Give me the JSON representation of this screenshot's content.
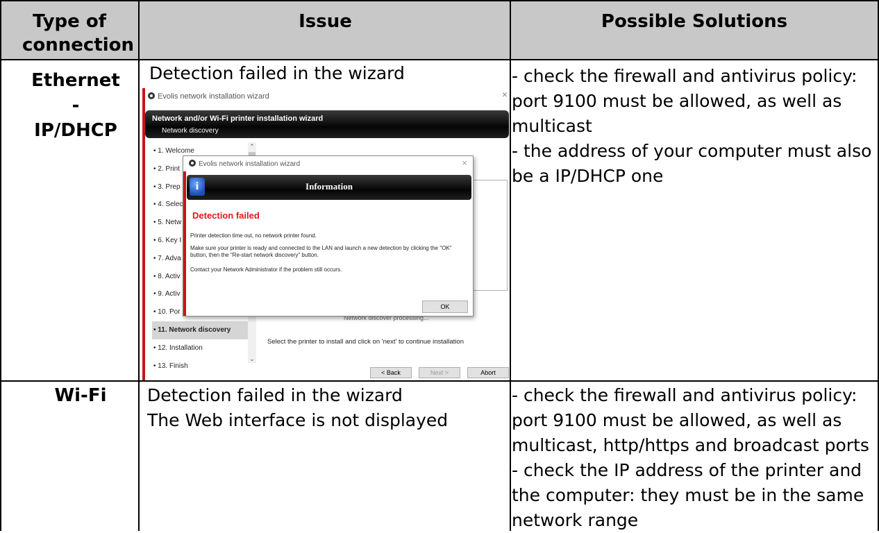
{
  "headers": {
    "type": "Type of connection",
    "issue": "Issue",
    "solutions": "Possible Solutions"
  },
  "rows": [
    {
      "connection": "Ethernet - IP/DHCP",
      "issue_line1": "Detection failed in the wizard",
      "solutions": [
        " - check the firewall and antivirus policy:",
        "port 9100 must be allowed, as well as",
        "multicast",
        " - the address of your computer must also",
        "be a IP/DHCP one"
      ]
    },
    {
      "connection": "Wi-Fi",
      "issue_lines": [
        "Detection failed in the wizard",
        "The Web interface is not displayed"
      ],
      "solutions": [
        " - check the firewall and antivirus policy:",
        "port 9100 must be allowed, as well as",
        "multicast, http/https and broadcast ports",
        "- check the IP address of the printer and",
        "the computer: they must be in the same",
        "network range"
      ]
    }
  ],
  "wizard": {
    "window_title": "Evolis network installation wizard",
    "banner_title": "Network and/or Wi-Fi printer installation wizard",
    "banner_subtitle": "Network discovery",
    "steps": [
      "1. Welcome",
      "2. Print",
      "3. Prep",
      "4. Selec",
      "5. Netw",
      "6. Key I",
      "7. Adva",
      "8. Activ",
      "9. Activ",
      "10. Por",
      "11. Network discovery",
      "12. Installation",
      "13. Finish"
    ],
    "active_step": 10,
    "spinner_text": "Network discover processing...",
    "instruction": "Select the printer to install and click on 'next' to continue installation",
    "btn_back": "< Back",
    "btn_next": "Next >",
    "btn_abort": "Abort",
    "accent_color": "#c4161c"
  },
  "dialog": {
    "window_title": "Evolis network installation wizard",
    "banner_title": "Information",
    "heading": "Detection failed",
    "p1": "Printer detection time out, no network printer found.",
    "p2": "Make sure your printer is ready and connected to the LAN and launch a new detection by clicking the \"OK\" button, then the \"Re-start network discovery\" button.",
    "p3": "Contact your Network Administrator if the problem still occurs.",
    "ok": "OK",
    "heading_color": "#e0161c"
  }
}
